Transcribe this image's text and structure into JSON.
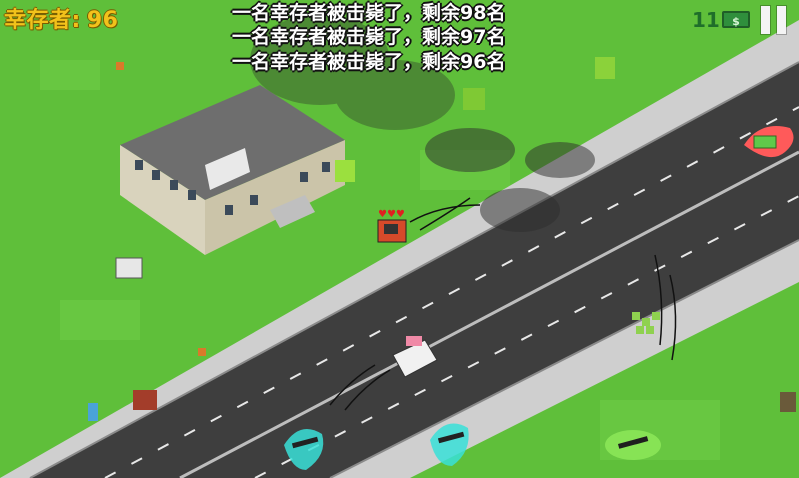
{
  "hud": {
    "survivors_label": "幸存者:",
    "survivors_count": "96",
    "kills_count": "11",
    "money_icon_glyph": "$",
    "pause_icon": "pause-icon"
  },
  "kill_feed": [
    "一名幸存者被击毙了，剩余98名",
    "一名幸存者被击毙了，剩余97名",
    "一名幸存者被击毙了，剩余96名"
  ],
  "colors": {
    "grass": "#5fbf3a",
    "road": "#3f3f3f",
    "sidewalk": "#cfcfcf",
    "survivor_text": "#f2c21b",
    "pickup_marker": "#38e0d8",
    "enemy_marker": "#ff5a5a"
  },
  "world": {
    "player": {
      "health_hearts": 3
    },
    "pickups": [
      "rifle-icon",
      "shotgun-icon",
      "melee-weapon-icon"
    ],
    "enemy_vehicle_marker": "car-icon"
  }
}
